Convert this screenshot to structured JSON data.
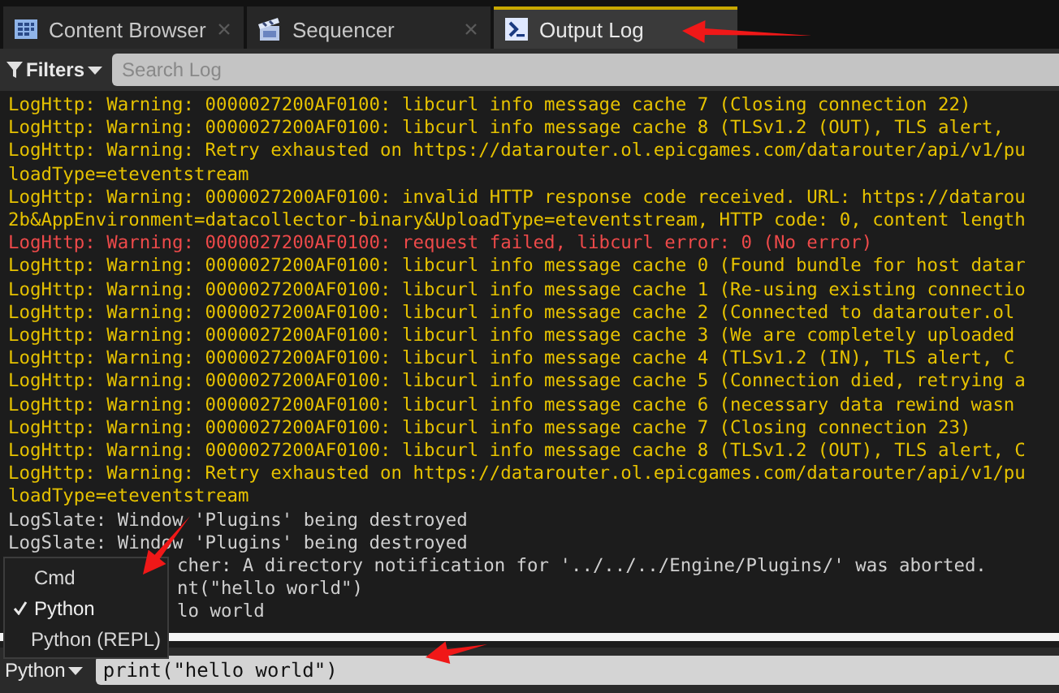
{
  "tabs": [
    {
      "label": "Content Browser",
      "selected": false,
      "closable": true
    },
    {
      "label": "Sequencer",
      "selected": false,
      "closable": true
    },
    {
      "label": "Output Log",
      "selected": true,
      "closable": false
    }
  ],
  "filter_bar": {
    "filters": "Filters",
    "search": {
      "placeholder": "Search Log"
    }
  },
  "log": {
    "lines": [
      {
        "text": "LogHttp: Warning: 0000027200AF0100: libcurl info message cache 7 (Closing connection 22)",
        "kind": "warning"
      },
      {
        "text": "LogHttp: Warning: 0000027200AF0100: libcurl info message cache 8 (TLSv1.2 (OUT), TLS alert,",
        "kind": "warning"
      },
      {
        "text": "LogHttp: Warning: Retry exhausted on https://datarouter.ol.epicgames.com/datarouter/api/v1/pu",
        "kind": "warning"
      },
      {
        "text": "loadType=eteventstream",
        "kind": "warning"
      },
      {
        "text": "LogHttp: Warning: 0000027200AF0100: invalid HTTP response code received. URL: https://datarou",
        "kind": "warning"
      },
      {
        "text": "2b&AppEnvironment=datacollector-binary&UploadType=eteventstream, HTTP code: 0, content length",
        "kind": "warning"
      },
      {
        "text": "LogHttp: Warning: 0000027200AF0100: request failed, libcurl error: 0 (No error)",
        "kind": "error"
      },
      {
        "text": "LogHttp: Warning: 0000027200AF0100: libcurl info message cache 0 (Found bundle for host datar",
        "kind": "warning"
      },
      {
        "text": "LogHttp: Warning: 0000027200AF0100: libcurl info message cache 1 (Re-using existing connectio",
        "kind": "warning"
      },
      {
        "text": "LogHttp: Warning: 0000027200AF0100: libcurl info message cache 2 (Connected to datarouter.ol",
        "kind": "warning"
      },
      {
        "text": "LogHttp: Warning: 0000027200AF0100: libcurl info message cache 3 (We are completely uploaded",
        "kind": "warning"
      },
      {
        "text": "LogHttp: Warning: 0000027200AF0100: libcurl info message cache 4 (TLSv1.2 (IN), TLS alert, C",
        "kind": "warning"
      },
      {
        "text": "LogHttp: Warning: 0000027200AF0100: libcurl info message cache 5 (Connection died, retrying a",
        "kind": "warning"
      },
      {
        "text": "LogHttp: Warning: 0000027200AF0100: libcurl info message cache 6 (necessary data rewind wasn",
        "kind": "warning"
      },
      {
        "text": "LogHttp: Warning: 0000027200AF0100: libcurl info message cache 7 (Closing connection 23)",
        "kind": "warning"
      },
      {
        "text": "LogHttp: Warning: 0000027200AF0100: libcurl info message cache 8 (TLSv1.2 (OUT), TLS alert, C",
        "kind": "warning"
      },
      {
        "text": "LogHttp: Warning: Retry exhausted on https://datarouter.ol.epicgames.com/datarouter/api/v1/pu",
        "kind": "warning"
      },
      {
        "text": "loadType=eteventstream",
        "kind": "warning"
      },
      {
        "text": "LogSlate: Window 'Plugins' being destroyed",
        "kind": "info"
      },
      {
        "text": "LogSlate: Window 'Plugins' being destroyed",
        "kind": "info"
      }
    ],
    "lines_beside_menu": [
      {
        "text": "cher: A directory notification for '../../../Engine/Plugins/' was aborted.",
        "kind": "info"
      },
      {
        "text": "nt(\"hello world\")",
        "kind": "info"
      },
      {
        "text": "lo world",
        "kind": "info"
      }
    ]
  },
  "interpreter_menu": {
    "items": [
      {
        "label": "Cmd",
        "selected": false
      },
      {
        "label": "Python",
        "selected": true
      },
      {
        "label": "Python (REPL)",
        "selected": false
      }
    ]
  },
  "console": {
    "interpreter": "Python",
    "value": "print(\"hello world\")"
  }
}
